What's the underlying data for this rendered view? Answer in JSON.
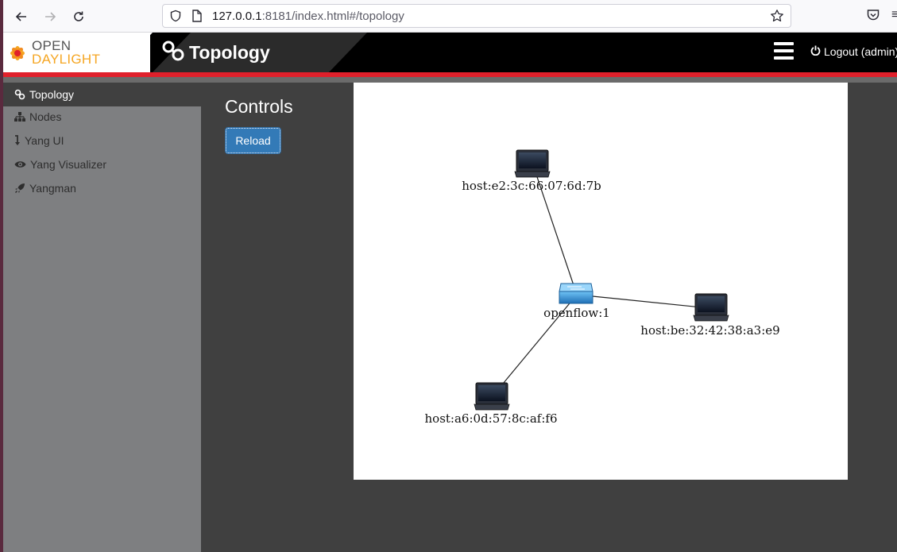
{
  "browser": {
    "url_host": "127.0.0.1",
    "url_rest": ":8181/index.html#/topology",
    "icons": [
      "back-arrow-icon",
      "forward-arrow-icon",
      "reload-icon",
      "shield-icon",
      "page-icon",
      "star-icon",
      "pocket-icon",
      "overflow-icon"
    ]
  },
  "header": {
    "logo_open": "OPEN",
    "logo_daylight": "DAYLIGHT",
    "title": "Topology",
    "logout": "Logout (admin)"
  },
  "colors": {
    "accent_red": "#e0202b",
    "logo_orange": "#f5a623",
    "button_blue": "#337ab7",
    "sidebar_gray": "#7e7f81",
    "main_dark": "#404040"
  },
  "sidebar": {
    "items": [
      {
        "label": "Topology",
        "icon": "link-icon",
        "active": true
      },
      {
        "label": "Nodes",
        "icon": "sitemap-icon",
        "active": false
      },
      {
        "label": "Yang UI",
        "icon": "arrow-down-icon",
        "active": false
      },
      {
        "label": "Yang Visualizer",
        "icon": "eye-icon",
        "active": false
      },
      {
        "label": "Yangman",
        "icon": "rocket-icon",
        "active": false
      }
    ]
  },
  "controls": {
    "title": "Controls",
    "reload_label": "Reload"
  },
  "topology": {
    "nodes": [
      {
        "id": "openflow:1",
        "label": "openflow:1",
        "type": "switch"
      },
      {
        "id": "host:e2:3c:66:07:6d:7b",
        "label": "host:e2:3c:66:07:6d:7b",
        "type": "host"
      },
      {
        "id": "host:be:32:42:38:a3:e9",
        "label": "host:be:32:42:38:a3:e9",
        "type": "host"
      },
      {
        "id": "host:a6:0d:57:8c:af:f6",
        "label": "host:a6:0d:57:8c:af:f6",
        "type": "host"
      }
    ],
    "links": [
      {
        "source": "openflow:1",
        "target": "host:e2:3c:66:07:6d:7b"
      },
      {
        "source": "openflow:1",
        "target": "host:be:32:42:38:a3:e9"
      },
      {
        "source": "openflow:1",
        "target": "host:a6:0d:57:8c:af:f6"
      }
    ]
  }
}
